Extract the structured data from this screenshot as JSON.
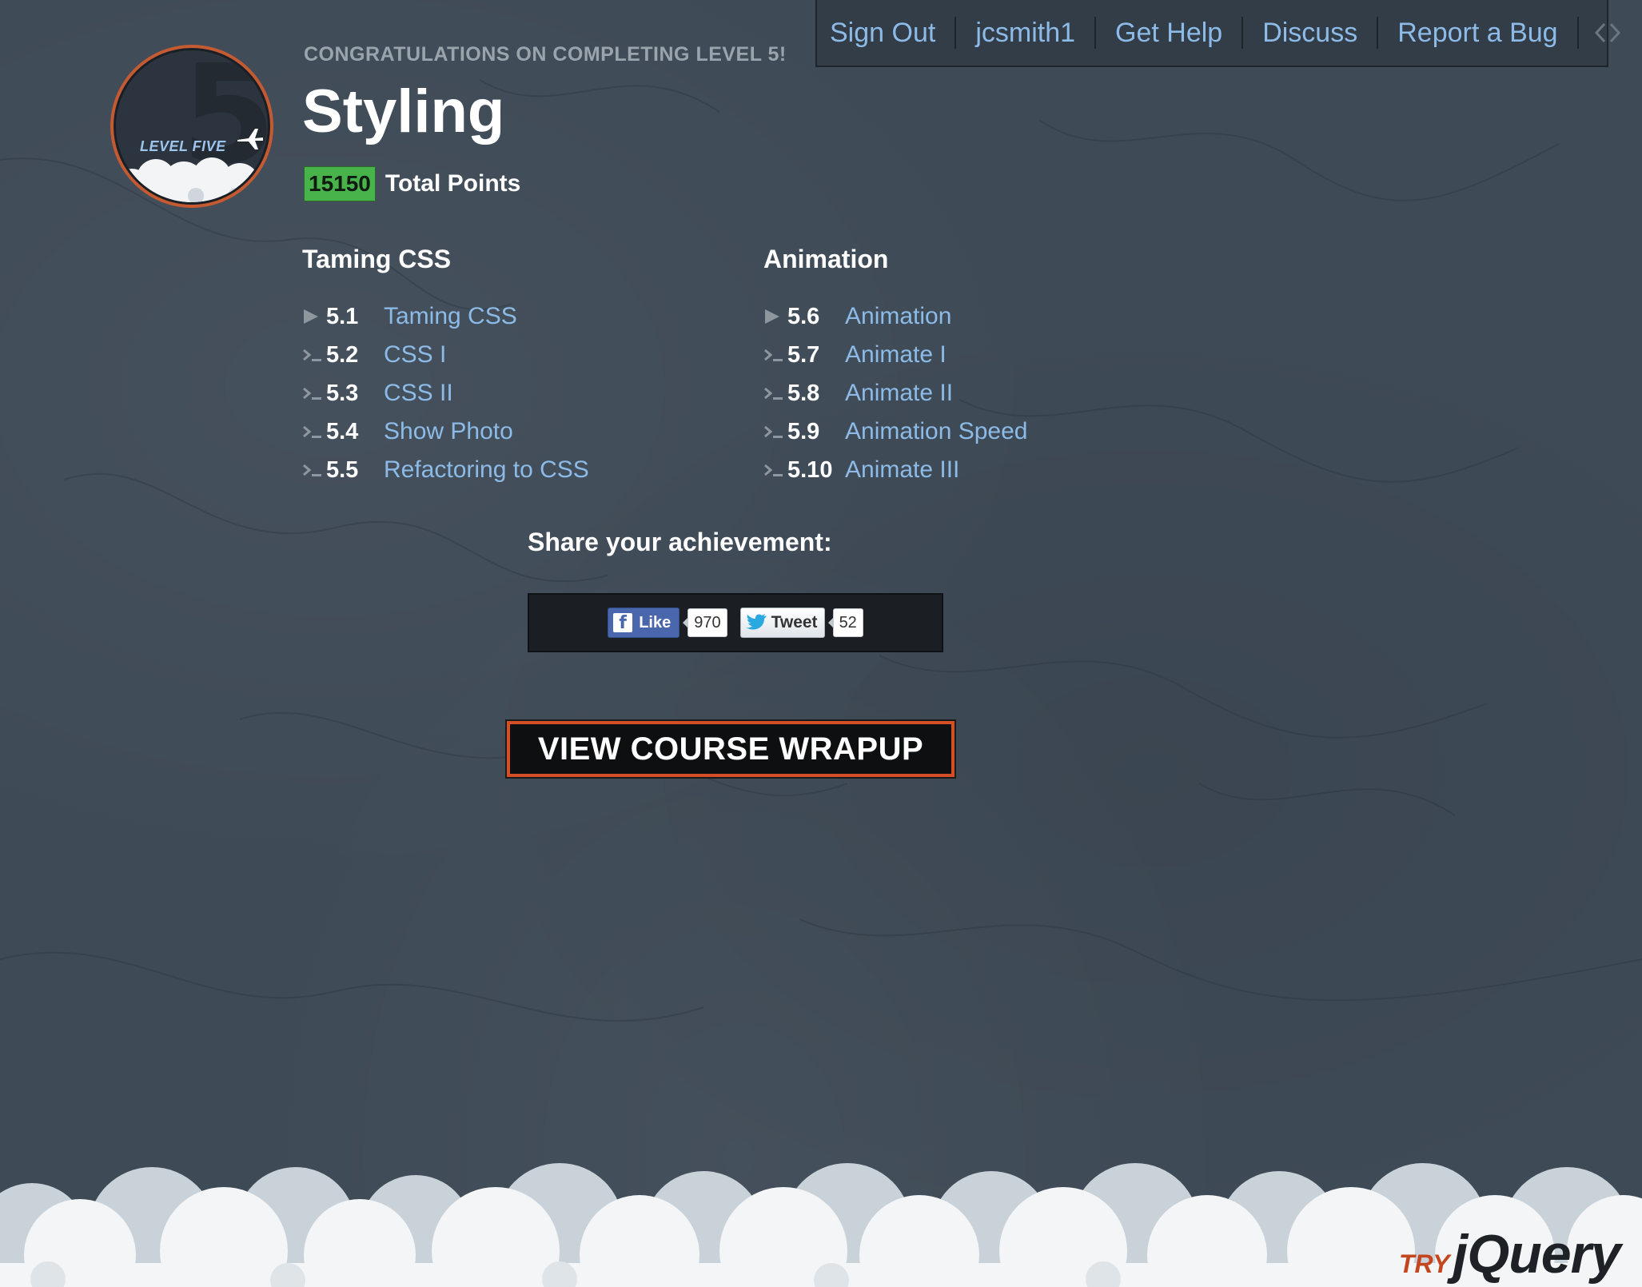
{
  "nav": {
    "items": [
      "Sign Out",
      "jcsmith1",
      "Get Help",
      "Discuss",
      "Report a Bug"
    ],
    "code_icon": "code-brackets-icon"
  },
  "badge": {
    "number": "5",
    "label": "LEVEL FIVE",
    "icon": "plane-icon"
  },
  "header": {
    "congrats": "CONGRATULATIONS ON COMPLETING LEVEL 5!",
    "title": "Styling",
    "points": "15150",
    "points_label": "Total Points"
  },
  "sections": [
    {
      "title": "Taming CSS",
      "lessons": [
        {
          "num": "5.1",
          "name": "Taming CSS",
          "icon": "play-icon"
        },
        {
          "num": "5.2",
          "name": "CSS I",
          "icon": "terminal-icon"
        },
        {
          "num": "5.3",
          "name": "CSS II",
          "icon": "terminal-icon"
        },
        {
          "num": "5.4",
          "name": "Show Photo",
          "icon": "terminal-icon"
        },
        {
          "num": "5.5",
          "name": "Refactoring to CSS",
          "icon": "terminal-icon"
        }
      ]
    },
    {
      "title": "Animation",
      "lessons": [
        {
          "num": "5.6",
          "name": "Animation",
          "icon": "play-icon"
        },
        {
          "num": "5.7",
          "name": "Animate I",
          "icon": "terminal-icon"
        },
        {
          "num": "5.8",
          "name": "Animate II",
          "icon": "terminal-icon"
        },
        {
          "num": "5.9",
          "name": "Animation Speed",
          "icon": "terminal-icon"
        },
        {
          "num": "5.10",
          "name": "Animate III",
          "icon": "terminal-icon"
        }
      ]
    }
  ],
  "share": {
    "title": "Share your achievement:",
    "fb_label": "Like",
    "fb_count": "970",
    "tw_label": "Tweet",
    "tw_count": "52"
  },
  "wrapup_label": "VIEW COURSE WRAPUP",
  "logo": {
    "try": "TRY",
    "brand": "jQuery"
  },
  "colors": {
    "background": "#3e4a56",
    "link": "#8dbbe8",
    "points_badge": "#49b34b",
    "accent_orange": "#d44e26"
  }
}
